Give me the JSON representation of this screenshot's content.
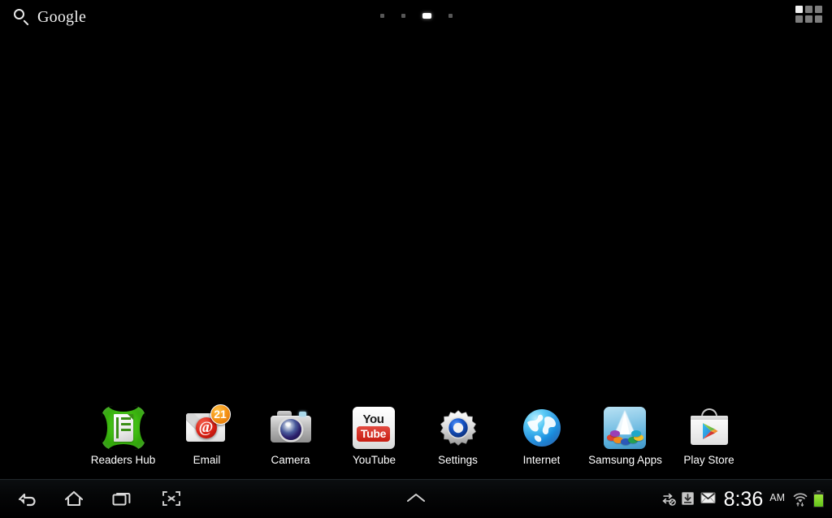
{
  "device": {
    "platform": "Android tablet home screen",
    "wallpaper_color": "#000000"
  },
  "top_bar": {
    "search": {
      "icon": "search-icon",
      "wordmark": "Google"
    },
    "apps_grid": {
      "icon": "apps-grid-icon",
      "label": "Apps"
    },
    "page_indicator": {
      "total": 4,
      "active_index": 2
    }
  },
  "dock": {
    "items": [
      {
        "label": "Readers Hub",
        "icon": "readers-hub-icon",
        "badge": null
      },
      {
        "label": "Email",
        "icon": "email-icon",
        "badge": "21"
      },
      {
        "label": "Camera",
        "icon": "camera-icon",
        "badge": null
      },
      {
        "label": "YouTube",
        "icon": "youtube-icon",
        "badge": null,
        "glyph_top": "You",
        "glyph_bottom": "Tube"
      },
      {
        "label": "Settings",
        "icon": "settings-gear-icon",
        "badge": null
      },
      {
        "label": "Internet",
        "icon": "internet-globe-icon",
        "badge": null
      },
      {
        "label": "Samsung Apps",
        "icon": "samsung-apps-icon",
        "badge": null
      },
      {
        "label": "Play Store",
        "icon": "play-store-icon",
        "badge": null
      }
    ]
  },
  "nav_bar": {
    "back": {
      "icon": "back-arrow-icon",
      "label": "Back"
    },
    "home": {
      "icon": "home-icon",
      "label": "Home"
    },
    "recent": {
      "icon": "recent-apps-icon",
      "label": "Recent apps"
    },
    "capture": {
      "icon": "screen-capture-icon",
      "label": "Screen capture"
    },
    "handle": {
      "icon": "chevron-up-icon",
      "label": "Show mini apps"
    }
  },
  "status_tray": {
    "icons": [
      {
        "name": "sound-off-icon",
        "label": "Sound off"
      },
      {
        "name": "download-icon",
        "label": "Download"
      },
      {
        "name": "gmail-icon",
        "label": "New mail"
      }
    ],
    "clock": {
      "time": "8:36",
      "ampm": "AM"
    },
    "wifi": {
      "name": "wifi-icon",
      "label": "Wi-Fi connected",
      "bars": 3
    },
    "battery": {
      "name": "battery-icon",
      "level_percent": 88,
      "color": "#7ed321"
    }
  },
  "colors": {
    "background": "#000000",
    "label_text": "#ffffff",
    "indicator_active": "#ffffff",
    "indicator_inactive": "#575757",
    "badge_orange": "#f59215",
    "readers_green": "#3fbb12",
    "youtube_red": "#c81c11",
    "battery_green": "#7ed321"
  }
}
